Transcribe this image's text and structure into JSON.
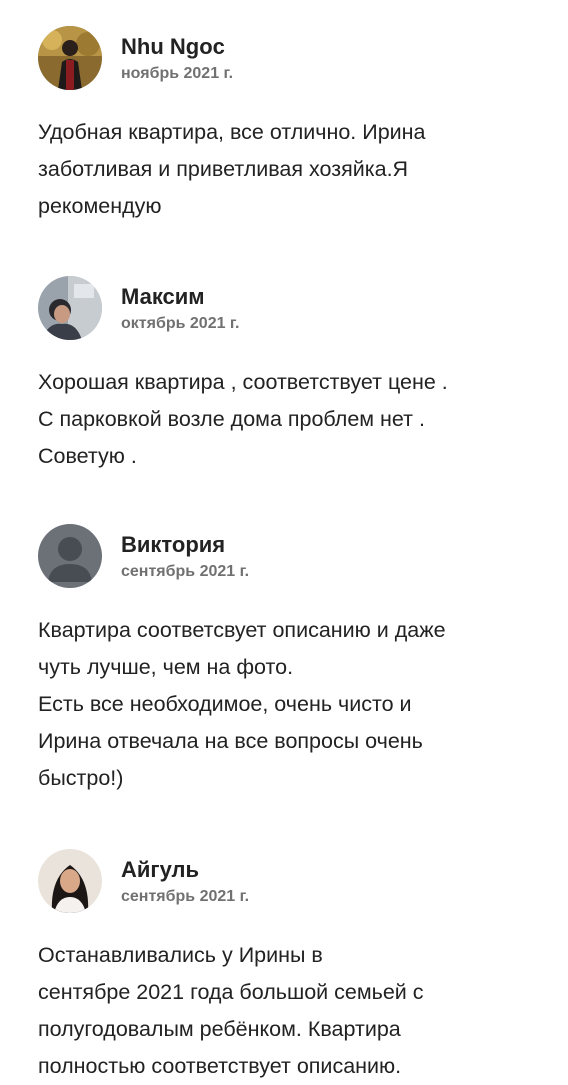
{
  "reviews": [
    {
      "name": "Nhu Ngoc",
      "date": "ноябрь 2021 г.",
      "avatar_icon": "user-photo",
      "paragraphs": [
        "Удобная квартира, все отлично. Ирина",
        "заботливая и приветливая хозяйка.Я",
        "рекомендую"
      ]
    },
    {
      "name": "Максим",
      "date": "октябрь 2021 г.",
      "avatar_icon": "user-photo",
      "paragraphs": [
        "Хорошая квартира , соответствует цене .",
        "С парковкой возле дома проблем нет .",
        "Советую ."
      ]
    },
    {
      "name": "Виктория",
      "date": "сентябрь 2021 г.",
      "avatar_icon": "default-user-icon",
      "paragraphs": [
        "Квартира соответсвует описанию и даже",
        "чуть лучше, чем на фото.",
        "Есть все необходимое, очень чисто и",
        "Ирина отвечала на все вопросы очень",
        "быстро!)"
      ]
    },
    {
      "name": "Айгуль",
      "date": "сентябрь 2021 г.",
      "avatar_icon": "user-photo",
      "paragraphs": [
        "Останавливались у Ирины в",
        "сентябре 2021 года большой семьей с",
        "полугодовалым ребёнком. Квартира",
        "полностью соответствует описанию."
      ]
    }
  ],
  "colors": {
    "text": "#222222",
    "secondary_text": "#717171",
    "placeholder_avatar_bg": "#6b7177",
    "placeholder_avatar_fg": "#474d53"
  }
}
